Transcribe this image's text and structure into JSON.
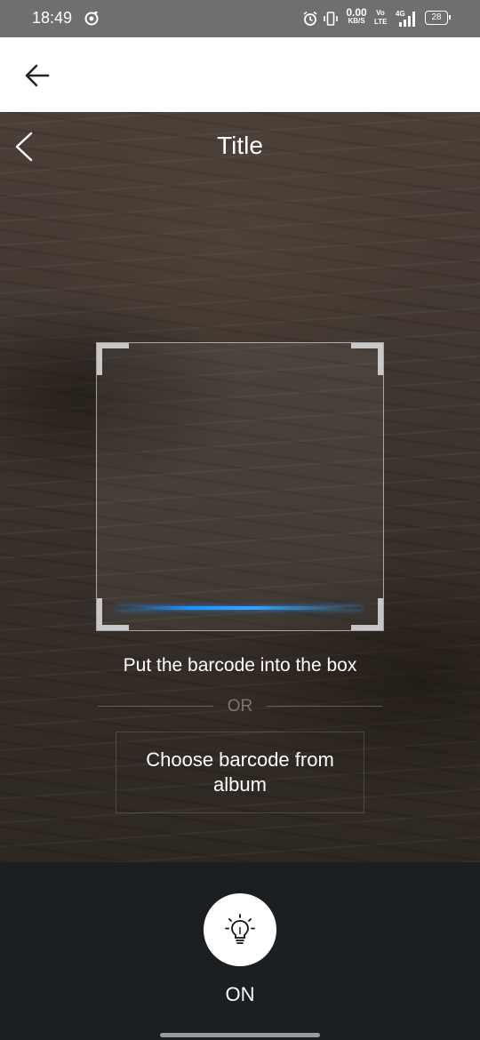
{
  "status_bar": {
    "time": "18:49",
    "net_speed_value": "0.00",
    "net_speed_unit": "KB/S",
    "volte": "Vo LTE",
    "network": "4G",
    "battery": "28"
  },
  "app_bar": {
    "back_icon": "arrow-left-icon"
  },
  "scanner": {
    "title": "Title",
    "back_icon": "chevron-left-icon",
    "instruction": "Put the barcode into the box",
    "or_label": "OR",
    "album_button_label": "Choose barcode from album",
    "scan_line_color": "#1e90ff"
  },
  "flashlight": {
    "icon": "lightbulb-icon",
    "state_label": "ON"
  }
}
